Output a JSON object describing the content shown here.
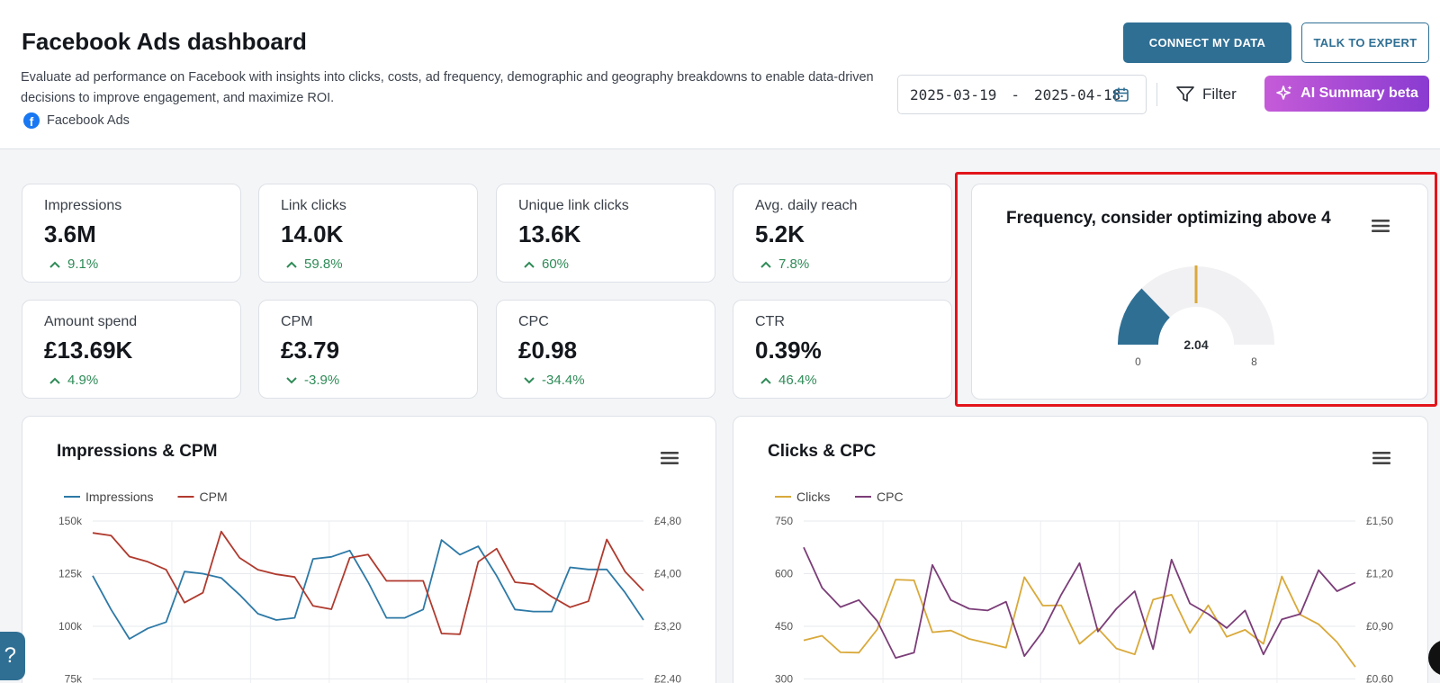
{
  "header": {
    "title": "Facebook Ads dashboard",
    "description": "Evaluate ad performance on Facebook with insights into clicks, costs, ad frequency, demographic and geography breakdowns to enable data-driven decisions to improve engagement, and maximize ROI.",
    "source": "Facebook Ads",
    "connect_label": "CONNECT MY DATA",
    "expert_label": "TALK TO EXPERT",
    "date_from": "2025-03-19",
    "date_sep": "-",
    "date_to": "2025-04-18",
    "filter_label": "Filter",
    "ai_label": "AI Summary beta"
  },
  "kpis": [
    {
      "label": "Impressions",
      "value": "3.6M",
      "delta": "9.1%",
      "trend": "up"
    },
    {
      "label": "Link clicks",
      "value": "14.0K",
      "delta": "59.8%",
      "trend": "up"
    },
    {
      "label": "Unique link clicks",
      "value": "13.6K",
      "delta": "60%",
      "trend": "up"
    },
    {
      "label": "Avg. daily reach",
      "value": "5.2K",
      "delta": "7.8%",
      "trend": "up"
    },
    {
      "label": "Amount spend",
      "value": "£13.69K",
      "delta": "4.9%",
      "trend": "up"
    },
    {
      "label": "CPM",
      "value": "£3.79",
      "delta": "-3.9%",
      "trend": "down"
    },
    {
      "label": "CPC",
      "value": "£0.98",
      "delta": "-34.4%",
      "trend": "down"
    },
    {
      "label": "CTR",
      "value": "0.39%",
      "delta": "46.4%",
      "trend": "up"
    }
  ],
  "colors": {
    "primary": "#2f6f94",
    "positive": "#2e8b57",
    "impressions": "#2d79a6",
    "cpm": "#b03a2e",
    "clicks": "#d9a93a",
    "cpc": "#7b3d78",
    "gauge_fill": "#2f6f94",
    "gauge_target": "#d9a93a",
    "highlight": "#e3141b"
  },
  "gauge": {
    "title": "Frequency, consider optimizing above 4",
    "value": 2.04,
    "value_label": "2.04",
    "min": 0,
    "max": 8,
    "min_label": "0",
    "max_label": "8",
    "target": 4
  },
  "chart_data": [
    {
      "type": "line",
      "title": "Impressions & CPM",
      "series": [
        {
          "name": "Impressions",
          "axis": "left",
          "values": [
            124000,
            108000,
            94000,
            99000,
            102000,
            126000,
            125000,
            123000,
            115000,
            106000,
            103000,
            104000,
            132000,
            133000,
            136000,
            121000,
            104000,
            104000,
            108000,
            141000,
            134000,
            138000,
            124000,
            108000,
            107000,
            107000,
            128000,
            127000,
            127000,
            116000,
            103000
          ]
        },
        {
          "name": "CPM",
          "axis": "right",
          "values": [
            4.62,
            4.58,
            4.26,
            4.18,
            4.06,
            3.56,
            3.71,
            4.64,
            4.24,
            4.06,
            3.99,
            3.95,
            3.51,
            3.46,
            4.24,
            4.29,
            3.89,
            3.89,
            3.89,
            3.09,
            3.08,
            4.18,
            4.38,
            3.87,
            3.84,
            3.65,
            3.49,
            3.58,
            4.52,
            4.03,
            3.74
          ]
        }
      ],
      "y_ticks": [
        "150k",
        "125k",
        "100k",
        "75k"
      ],
      "y2_ticks": [
        "£4,80",
        "£4,00",
        "£3,20",
        "£2,40"
      ],
      "ylim": [
        75000,
        150000
      ],
      "y2lim": [
        2.4,
        4.8
      ],
      "grid": true,
      "legend": "top-left"
    },
    {
      "type": "line",
      "title": "Clicks & CPC",
      "series": [
        {
          "name": "Clicks",
          "axis": "left",
          "values": [
            410,
            423,
            376,
            375,
            441,
            583,
            581,
            433,
            438,
            414,
            402,
            389,
            590,
            509,
            510,
            400,
            444,
            387,
            370,
            526,
            540,
            431,
            510,
            420,
            440,
            400,
            592,
            483,
            456,
            405,
            334
          ]
        },
        {
          "name": "CPC",
          "axis": "right",
          "values": [
            1.35,
            1.12,
            1.01,
            1.05,
            0.93,
            0.72,
            0.75,
            1.25,
            1.05,
            1.0,
            0.99,
            1.04,
            0.73,
            0.87,
            1.08,
            1.26,
            0.87,
            1.0,
            1.1,
            0.77,
            1.28,
            1.03,
            0.97,
            0.89,
            0.99,
            0.74,
            0.94,
            0.97,
            1.22,
            1.1,
            1.15
          ]
        }
      ],
      "y_ticks": [
        "750",
        "600",
        "450",
        "300"
      ],
      "y2_ticks": [
        "£1,50",
        "£1,20",
        "£0,90",
        "£0,60"
      ],
      "ylim": [
        300,
        750
      ],
      "y2lim": [
        0.6,
        1.5
      ],
      "grid": true,
      "legend": "top-left"
    }
  ],
  "help": {
    "label": "?"
  }
}
